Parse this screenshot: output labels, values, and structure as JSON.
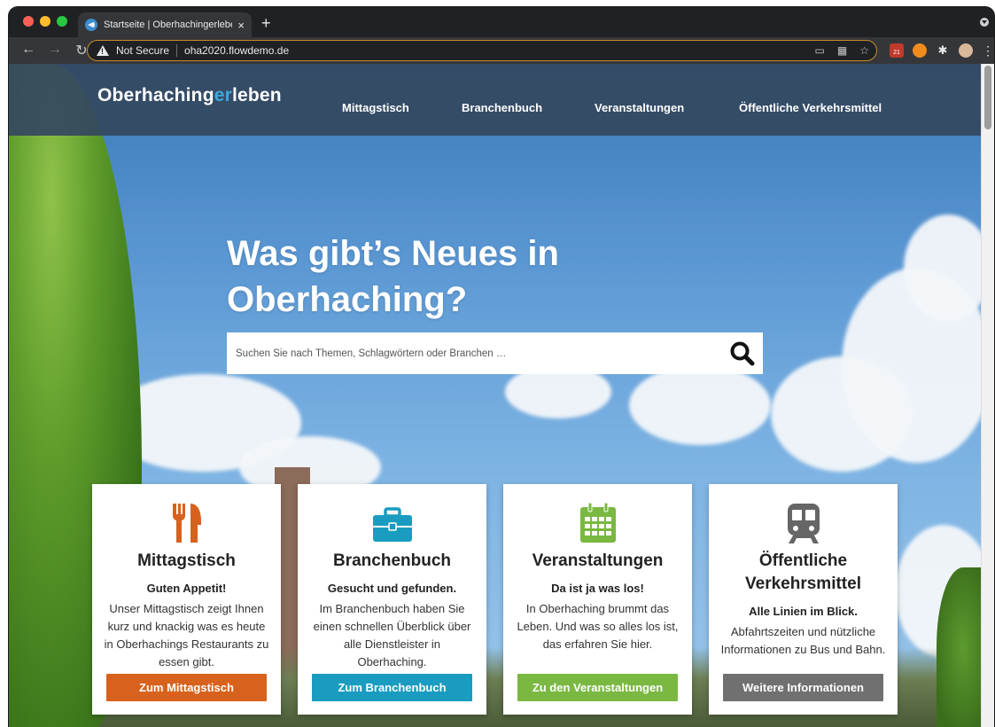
{
  "browser": {
    "tab_title": "Startseite | Oberhachingerlebe",
    "new_tab_label": "+",
    "tab_close_label": "×",
    "security_label": "Not Secure",
    "url": "oha2020.flowdemo.de",
    "calendar_ext_badge": "21"
  },
  "site": {
    "logo_part1": "Oberhaching",
    "logo_accent": "er",
    "logo_part2": "leben",
    "nav": [
      {
        "label": "Mittagstisch"
      },
      {
        "label": "Branchenbuch"
      },
      {
        "label": "Veranstaltungen"
      },
      {
        "label": "Öffentliche Verkehrsmittel"
      }
    ]
  },
  "hero": {
    "title_line1": "Was gibt’s Neues in",
    "title_line2": "Oberhaching?",
    "search_placeholder": "Suchen Sie nach Themen, Schlagwörtern oder Branchen …"
  },
  "cards": [
    {
      "title": "Mittagstisch",
      "subtitle": "Guten Appetit!",
      "text": "Unser Mittagstisch zeigt Ihnen kurz und knackig was es heute in Oberhachings Restaurants zu essen gibt.",
      "button": "Zum Mittagstisch",
      "color": "#d7621d",
      "icon": "cutlery-icon"
    },
    {
      "title": "Branchenbuch",
      "subtitle": "Gesucht und gefunden.",
      "text": "Im Branchenbuch haben Sie einen schnellen Überblick über alle Dienstleister in Oberhaching.",
      "button": "Zum Branchenbuch",
      "color": "#199cbf",
      "icon": "briefcase-icon"
    },
    {
      "title": "Veranstaltungen",
      "subtitle": "Da ist ja was los!",
      "text": "In Oberhaching brummt das Leben. Und was so alles los ist, das erfahren Sie hier.",
      "button": "Zu den Veranstaltungen",
      "color": "#7ab842",
      "icon": "calendar-icon"
    },
    {
      "title_line1": "Öffentliche",
      "title_line2": "Verkehrsmittel",
      "subtitle": "Alle Linien im Blick.",
      "text": "Abfahrtszeiten und nützliche Informationen zu Bus und Bahn.",
      "button": "Weitere Informationen",
      "color": "#707070",
      "icon": "train-icon"
    }
  ]
}
